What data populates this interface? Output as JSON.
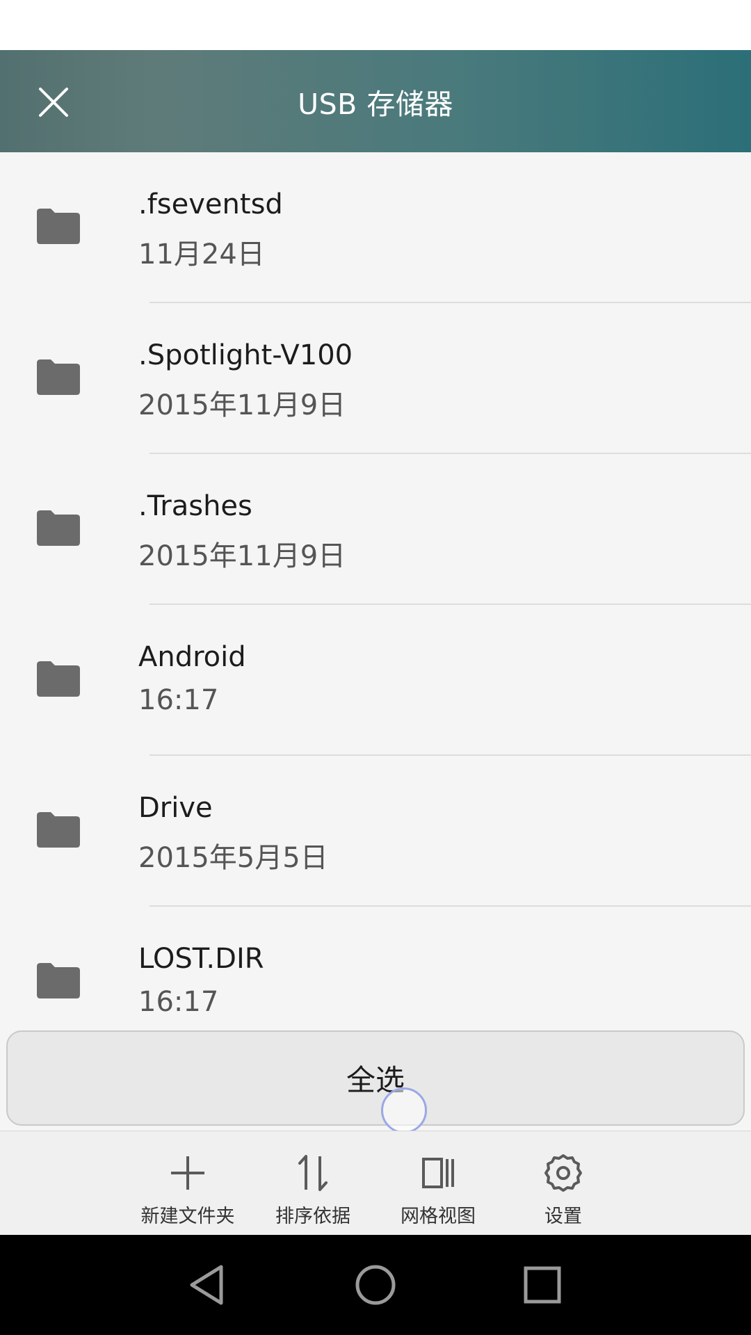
{
  "header": {
    "title": "USB 存储器"
  },
  "files": [
    {
      "name": ".fseventsd",
      "date": "11月24日",
      "icon": "folder-icon"
    },
    {
      "name": ".Spotlight-V100",
      "date": "2015年11月9日",
      "icon": "folder-icon"
    },
    {
      "name": ".Trashes",
      "date": "2015年11月9日",
      "icon": "folder-icon"
    },
    {
      "name": "Android",
      "date": "16:17",
      "icon": "folder-icon"
    },
    {
      "name": "Drive",
      "date": "2015年5月5日",
      "icon": "folder-icon"
    },
    {
      "name": "LOST.DIR",
      "date": "16:17",
      "icon": "folder-icon"
    }
  ],
  "select_all": {
    "label": "全选"
  },
  "toolbar": {
    "new_folder": "新建文件夹",
    "sort_by": "排序依据",
    "grid_view": "网格视图",
    "settings": "设置"
  },
  "colors": {
    "header_gradient_start": "#52706f",
    "header_gradient_end": "#2c6f78",
    "folder": "#6b6b6b"
  }
}
